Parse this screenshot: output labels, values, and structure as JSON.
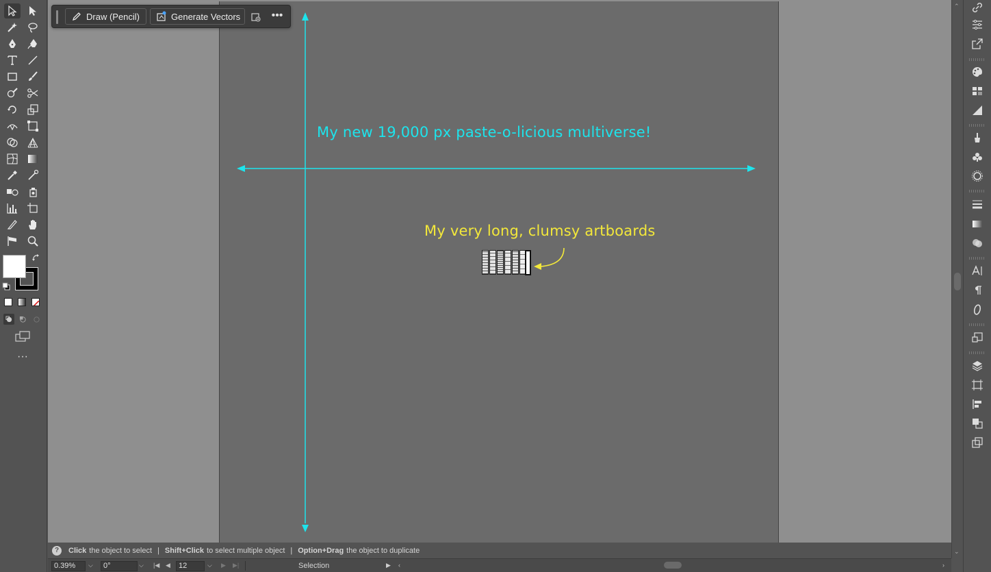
{
  "context_toolbar": {
    "draw_label": "Draw (Pencil)",
    "generate_label": "Generate Vectors"
  },
  "canvas": {
    "headline": "My new 19,000 px paste-o-licious multiverse!",
    "caption": "My very long, clumsy artboards",
    "colors": {
      "annotation_cyan": "#1de4ec",
      "annotation_yellow": "#f3e83a",
      "pasteboard": "#8f8f8f",
      "artboard": "#6b6b6b"
    }
  },
  "status": {
    "part1_bold": "Click",
    "part1": "the object to select",
    "sep": "|",
    "part2_bold": "Shift+Click",
    "part2": "to select multiple object",
    "part3_bold": "Option+Drag",
    "part3": "the object to duplicate"
  },
  "bottom": {
    "zoom": "0.39%",
    "rotation": "0°",
    "artboard_number": "12",
    "current_tool": "Selection"
  },
  "icons": {
    "left_tools": [
      "selection-tool-icon",
      "direct-selection-tool-icon",
      "magic-wand-icon",
      "lasso-icon",
      "pen-icon",
      "curvature-icon",
      "type-icon",
      "line-segment-icon",
      "rectangle-icon",
      "paintbrush-icon",
      "shaper-icon",
      "scissors-icon",
      "rotate-icon",
      "scale-icon",
      "width-icon",
      "free-transform-icon",
      "shape-builder-icon",
      "perspective-grid-icon",
      "mesh-icon",
      "gradient-icon",
      "eyedropper-icon",
      "measure-icon",
      "blend-icon",
      "symbol-sprayer-icon",
      "column-graph-icon",
      "artboard-icon",
      "slice-icon",
      "hand-icon",
      "puppet-warp-icon",
      "zoom-icon"
    ],
    "right_panels": [
      "links-icon",
      "properties-icon",
      "export-icon",
      "color-icon",
      "swatches-icon",
      "color-guide-icon",
      "brushes-icon",
      "symbols-icon",
      "graphic-styles-icon",
      "stroke-icon",
      "gradient-panel-icon",
      "transparency-icon",
      "character-icon",
      "paragraph-icon",
      "opentype-icon",
      "asset-export-icon",
      "layers-icon",
      "artboards-icon",
      "align-icon",
      "pathfinder-icon",
      "transform-icon"
    ]
  }
}
